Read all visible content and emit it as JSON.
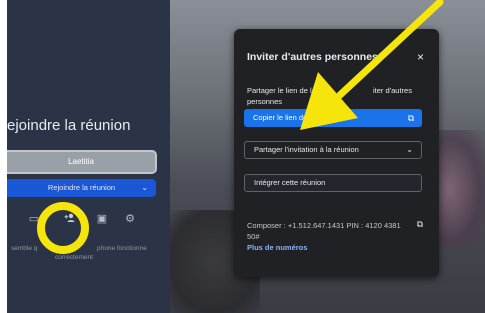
{
  "join": {
    "title": "ejoindre la réunion",
    "name_value": "Laetitia",
    "join_button": "Rejoindre la réunion",
    "audio_text_line1": "semble q",
    "audio_text_line1b": "phone fonctionne",
    "audio_text_line2": "correctement"
  },
  "dialog": {
    "title": "Inviter d'autres personnes",
    "close_icon": "×",
    "desc_line1_start": "Partager le lien de la",
    "desc_line1_end": "iter d'autres",
    "desc_line2": "personnes",
    "copy_link_label": "Copier le lien de la réunion",
    "share_invitation_label": "Partager l'invitation à la réunion",
    "embed_label": "Intégrer cette réunion",
    "dial_in_text": "Composer : +1.512.647.1431 PIN : 4120 4381 50#",
    "more_numbers_label": "Plus de numéros"
  },
  "icons": {
    "add_person": "add-person-icon",
    "settings": "gear-icon",
    "copy": "copy-icon"
  },
  "colors": {
    "primary_button": "#1a73e8",
    "link": "#8ab4f8",
    "annotation": "#f5e50a"
  }
}
